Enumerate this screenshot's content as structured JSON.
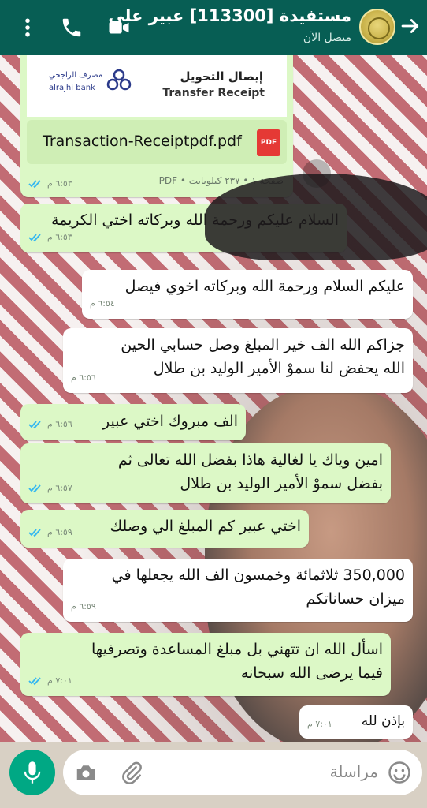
{
  "header": {
    "contact_name": "مستفيدة [113300] عبير علي",
    "status": "متصل الآن"
  },
  "attachment": {
    "receipt_title_ar": "إيصال التحويل",
    "receipt_title_en": "Transfer Receipt",
    "bank_name_ar": "مصرف الراجحي",
    "bank_name_en": "alrajhi bank",
    "file_name": "Transaction-Receiptpdf.pdf",
    "file_type_badge": "PDF",
    "file_info": "صفحة ١ • ٢٣٧ كيلوبايت • PDF",
    "time": "٦:٥٣ م"
  },
  "messages": [
    {
      "dir": "out",
      "text": "السلام عليكم ورحمة الله وبركاته اختي الكريمة",
      "time": "٦:٥٣ م"
    },
    {
      "dir": "in",
      "text": "عليكم السلام ورحمة الله وبركاته اخوي فيصل",
      "time": "٦:٥٤ م"
    },
    {
      "dir": "in",
      "text": "جزاكم الله الف خير المبلغ وصل حسابي الحين\nالله يحفض لنا سموْ الأمير الوليد بن طلال",
      "time": "٦:٥٦ م"
    },
    {
      "dir": "out",
      "text": "الف مبروك اختي عبير",
      "time": "٦:٥٦ م"
    },
    {
      "dir": "out",
      "text": "امين وياك يا لغالية هاذا بفضل الله تعالى ثم\nبفضل سموْ الأمير الوليد بن طلال",
      "time": "٦:٥٧ م"
    },
    {
      "dir": "out",
      "text": "اختي عبير كم المبلغ الي وصلك",
      "time": "٦:٥٩ م"
    },
    {
      "dir": "in",
      "text": "350,000 ثلاثمائة وخمسون الف الله يجعلها في\nميزان حساناتكم",
      "time": "٦:٥٩ م"
    },
    {
      "dir": "out",
      "text": "اسأل الله ان تتهني بل مبلغ المساعدة وتصرفيها\nفيما يرضى الله سبحانه",
      "time": "٧:٠١ م"
    },
    {
      "dir": "in",
      "text": "بإذن لله",
      "time": "٧:٠١ م"
    }
  ],
  "input": {
    "placeholder": "مراسلة"
  },
  "colors": {
    "header": "#075e54",
    "outgoing_bubble": "#dcf8c6",
    "incoming_bubble": "#ffffff",
    "read_ticks": "#34b7f1",
    "mic_button": "#00a884"
  }
}
